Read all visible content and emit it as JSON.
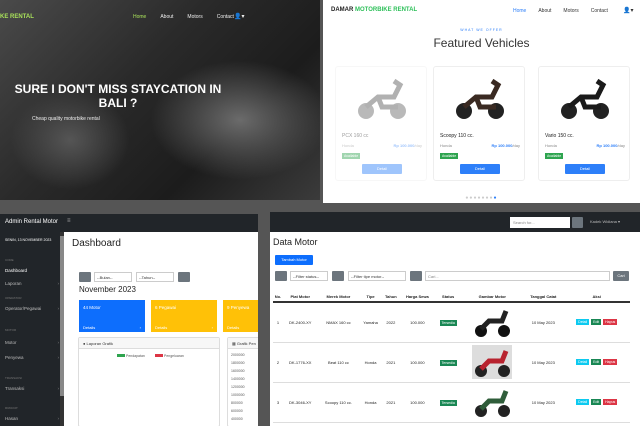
{
  "hero": {
    "brand": "KE RENTAL",
    "nav": [
      "Home",
      "About",
      "Motors",
      "Contact"
    ],
    "user_icon": "user-icon",
    "title": "SURE I DON'T MISS STAYCATION IN BALI ?",
    "subtitle": "Cheap quality motorbike rental"
  },
  "vehicles": {
    "brand_a": "DAMAR",
    "brand_b": "MOTORBIKE RENTAL",
    "nav": [
      "Home",
      "About",
      "Motors",
      "Contact"
    ],
    "eyebrow": "WHAT WE OFFER",
    "heading": "Featured Vehicles",
    "cards": [
      {
        "name": "PCX 160 cc",
        "brand": "Honda",
        "price": "Rp 100.000",
        "unit": "/day",
        "status": "Available",
        "button": "Detail"
      },
      {
        "name": "Scoopy 110 cc.",
        "brand": "Honda",
        "price": "Rp 100.000",
        "unit": "/day",
        "status": "Available",
        "button": "Detail"
      },
      {
        "name": "Vario 150 cc.",
        "brand": "Honda",
        "price": "Rp 100.000",
        "unit": "/day",
        "status": "Available",
        "button": "Detail"
      }
    ]
  },
  "dashboard": {
    "app_title": "Admin Rental Motor",
    "date": "SENIN, 13 NOVEMBER 2023",
    "title": "Dashboard",
    "sidebar": [
      {
        "group": "CORE",
        "item": "Dashboard"
      },
      {
        "group": "",
        "item": "Laporan"
      },
      {
        "group": "OPERATOR",
        "item": "Operator/Pegawai"
      },
      {
        "group": "MOTOR",
        "item": "Motor"
      },
      {
        "group": "",
        "item": "Penyewa"
      },
      {
        "group": "TRANSAKSI",
        "item": "Transaksi"
      },
      {
        "group": "RIWAYAT",
        "item": "Hasan"
      }
    ],
    "filter_bulan": "--Bulan--",
    "filter_tahun": "--Tahun--",
    "month": "November 2023",
    "tiles": [
      {
        "value": "44 Motor",
        "detail": "Details",
        "color": "#0d6efd"
      },
      {
        "value": "6 Pegawai",
        "detail": "Details",
        "color": "#ffc107"
      },
      {
        "value": "9 Penyewa",
        "detail": "Details",
        "color": "#ffc107"
      }
    ],
    "lap_title": "Laporan Grafik",
    "legend": [
      "Pendapatan",
      "Pengeluaran"
    ],
    "grafik_title": "Grafik Pen",
    "yticks": [
      "2000000",
      "1800000",
      "1600000",
      "1400000",
      "1200000",
      "1000000",
      "800000",
      "600000",
      "400000"
    ]
  },
  "data_motor": {
    "search_placeholder": "Search for...",
    "user": "Kadek Widiana",
    "title": "Data Motor",
    "add_button": "Tambah Motor",
    "filter_status": "--Filter status--",
    "filter_tipe": "--Filter tipe motor--",
    "cari_placeholder": "Cari...",
    "cari_button": "Cari",
    "columns": [
      "No.",
      "Plat Motor",
      "Merek Motor",
      "Tipe",
      "Tahun",
      "Harga Sewa",
      "Status",
      "Gambar Motor",
      "Tanggal Catat",
      "Aksi"
    ],
    "rows": [
      {
        "no": "1",
        "plat": "DK-2400-XY",
        "merek": "NMAX 160 cc",
        "tipe": "Yamaha",
        "tahun": "2022",
        "harga": "100.000",
        "status": "Tersedia",
        "img": "dark",
        "tanggal": "10 May 2023"
      },
      {
        "no": "2",
        "plat": "DK-1776-XX",
        "merek": "Beat 110 cc",
        "tipe": "Honda",
        "tahun": "2021",
        "harga": "100.000",
        "status": "Tersedia",
        "img": "red",
        "tanggal": "10 May 2023"
      },
      {
        "no": "3",
        "plat": "DK-3046-XY",
        "merek": "Scoopy 110 cc.",
        "tipe": "Honda",
        "tahun": "2021",
        "harga": "100.000",
        "status": "Tersedia",
        "img": "green",
        "tanggal": "10 May 2023"
      }
    ],
    "actions": [
      "Detail",
      "Edit",
      "Hapus"
    ]
  }
}
